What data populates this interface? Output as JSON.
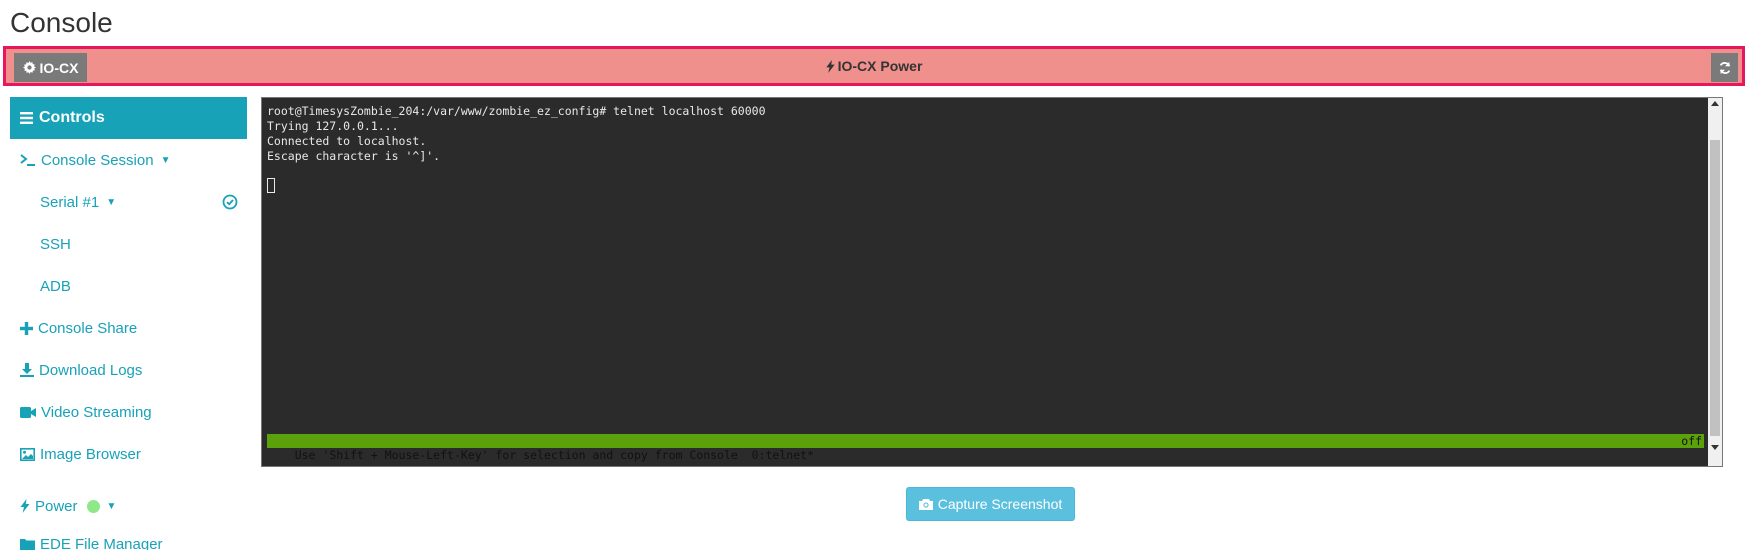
{
  "page": {
    "title": "Console"
  },
  "power_bar": {
    "device_label": "IO-CX",
    "title": "IO-CX Power",
    "colors": {
      "border": "#e8175d",
      "background": "#f0908d"
    }
  },
  "sidebar": {
    "header": "Controls",
    "items": [
      {
        "label": "Console Session",
        "icon": "terminal-icon"
      },
      {
        "label": "Serial #1",
        "icon": "none"
      },
      {
        "label": "SSH",
        "icon": "none"
      },
      {
        "label": "ADB",
        "icon": "none"
      },
      {
        "label": "Console Share",
        "icon": "plus-icon"
      },
      {
        "label": "Download Logs",
        "icon": "download-icon"
      },
      {
        "label": "Video Streaming",
        "icon": "video-camera-icon"
      },
      {
        "label": "Image Browser",
        "icon": "image-icon"
      },
      {
        "label": "Power",
        "icon": "bolt-icon"
      },
      {
        "label": "EDE File Manager",
        "icon": "folder-icon"
      }
    ]
  },
  "console": {
    "lines": [
      "root@TimesysZombie_204:/var/www/zombie_ez_config# telnet localhost 60000",
      "Trying 127.0.0.1...",
      "Connected to localhost.",
      "Escape character is '^]'."
    ],
    "status_left": "Use 'Shift + Mouse-Left-Key' for selection and copy from Console  0:telnet*",
    "status_right": "off"
  },
  "actions": {
    "capture_label": "Capture Screenshot"
  }
}
